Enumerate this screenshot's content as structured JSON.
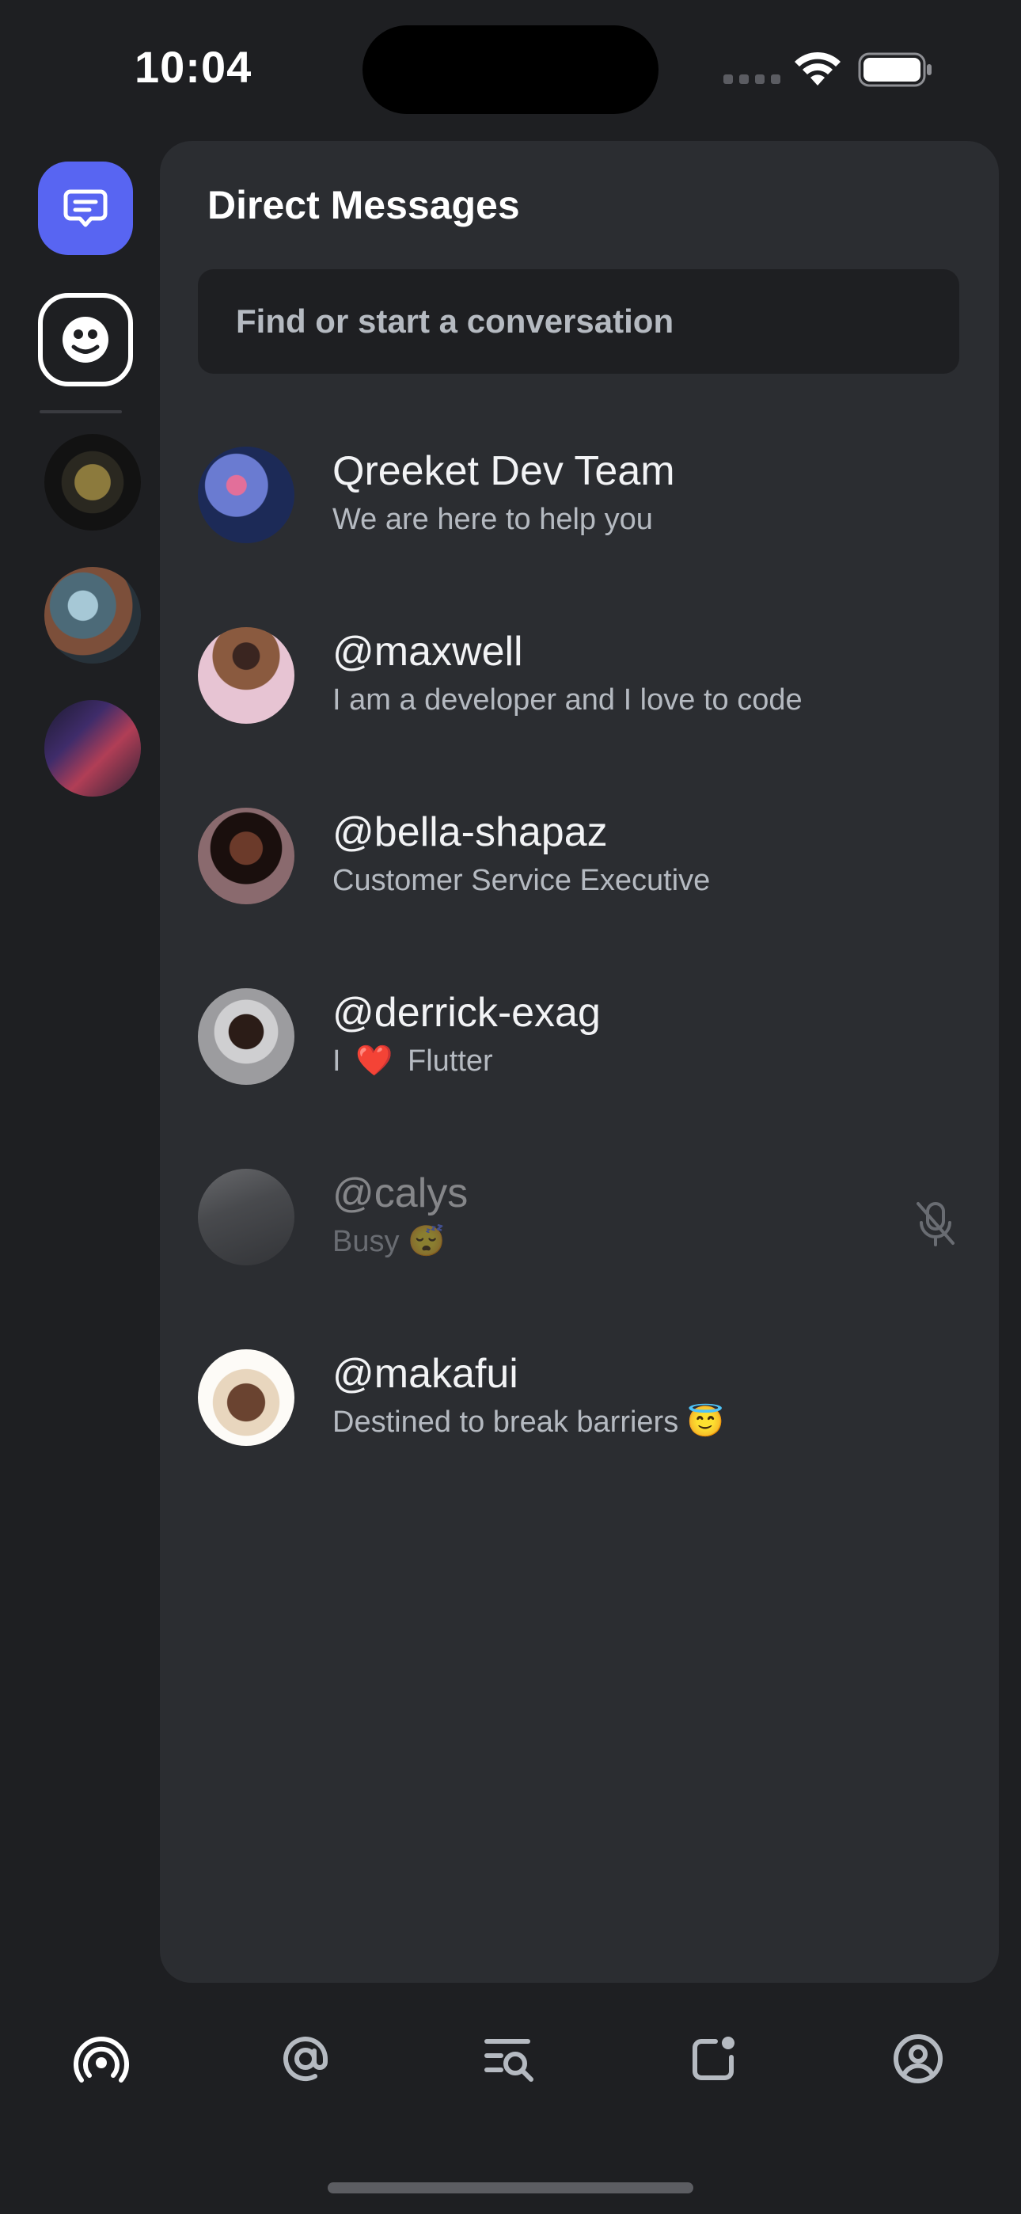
{
  "status_bar": {
    "time": "10:04"
  },
  "panel": {
    "title": "Direct Messages",
    "search": {
      "placeholder": "Find or start a conversation"
    }
  },
  "conversations": [
    {
      "name": "Qreeket Dev Team",
      "status": "We are here to help you",
      "avatar_color": "#3b4a8a"
    },
    {
      "name": "@maxwell",
      "status": "I am a developer and I love to code",
      "avatar_color": "#c9a4b6"
    },
    {
      "name": "@bella-shapaz",
      "status": "Customer Service Executive",
      "avatar_color": "#3a1f1c"
    },
    {
      "name": "@derrick-exag",
      "status_text": "I",
      "status_emoji": "❤️",
      "status_text_2": "Flutter",
      "avatar_color": "#b9b9bb"
    },
    {
      "name": "@calys",
      "status": "Busy 😴",
      "muted": true,
      "avatar_color": "#6b6c70"
    },
    {
      "name": "@makafui",
      "status": "Destined to break barriers 😇",
      "avatar_color": "#6a4a35"
    }
  ],
  "bottom_nav": [
    "broadcast-icon",
    "mention-icon",
    "search-list-icon",
    "notification-icon",
    "profile-icon"
  ],
  "colors": {
    "accent": "#5865f2",
    "background": "#1e1f22",
    "panel": "#2b2d31",
    "secondary_text": "#b5bac1"
  }
}
